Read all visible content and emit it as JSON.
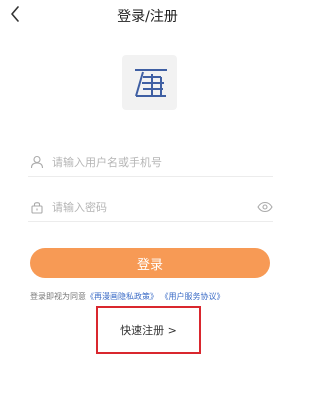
{
  "header": {
    "title": "登录/注册",
    "back_icon": "chevron-left-icon"
  },
  "logo": {
    "glyph": "再",
    "color": "#3f5fa3"
  },
  "form": {
    "username_placeholder": "请输入用户名或手机号",
    "password_placeholder": "请输入密码",
    "login_label": "登录",
    "accent_color": "#f79a55"
  },
  "agreement": {
    "prefix": "登录即视为同意",
    "privacy_link": "《再漫画隐私政策》",
    "service_link": "《用户服务协议》"
  },
  "quick_register": {
    "label": "快速注册 >",
    "highlight_color": "#d9272e"
  }
}
